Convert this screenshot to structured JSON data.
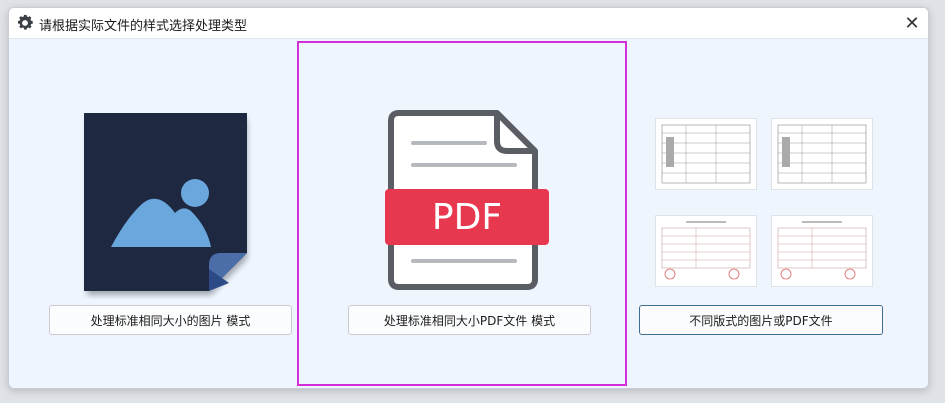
{
  "window": {
    "title": "请根据实际文件的样式选择处理类型",
    "close_glyph": "✕"
  },
  "options": {
    "image_mode": {
      "label": "处理标准相同大小的图片 模式"
    },
    "pdf_mode": {
      "label": "处理标准相同大小PDF文件 模式",
      "badge_text": "PDF"
    },
    "mixed_mode": {
      "label": "不同版式的图片或PDF文件"
    }
  },
  "colors": {
    "selection_border": "#d12fd8",
    "pdf_badge": "#e8384f",
    "image_icon_bg": "#1e2840",
    "image_icon_fg": "#6aa7dc"
  },
  "icons": [
    "gear-icon",
    "close-icon",
    "image-file-icon",
    "pdf-file-icon",
    "document-thumbnail"
  ]
}
